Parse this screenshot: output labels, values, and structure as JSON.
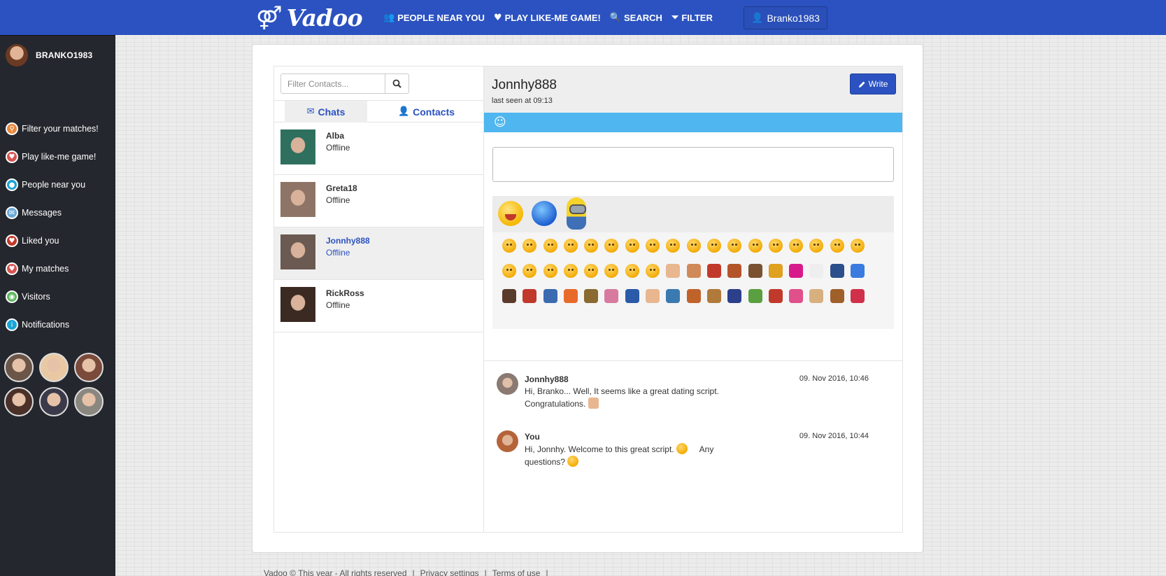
{
  "brand": {
    "symbol": "⚤",
    "name": "Vadoo"
  },
  "nav": [
    {
      "icon": "users-icon",
      "glyph": "👥",
      "label": "PEOPLE NEAR YOU"
    },
    {
      "icon": "heart-icon",
      "glyph": "♥",
      "label": "PLAY LIKE-ME GAME!"
    },
    {
      "icon": "search-icon",
      "glyph": "🔍",
      "label": "SEARCH"
    },
    {
      "icon": "filter-icon",
      "glyph": "⏷",
      "label": "FILTER"
    }
  ],
  "user_button": {
    "glyph": "👤",
    "label": "Branko1983"
  },
  "sidebar": {
    "username": "BRANKO1983",
    "items": [
      {
        "label": "Filter your matches!",
        "color": "#e8873b",
        "glyph": "⚲"
      },
      {
        "label": "Play like-me game!",
        "color": "#d9534f",
        "glyph": "♥"
      },
      {
        "label": "People near you",
        "color": "#1aa3d6",
        "glyph": "●"
      },
      {
        "label": "Messages",
        "color": "#6aa9d8",
        "glyph": "✉"
      },
      {
        "label": "Liked you",
        "color": "#c0392b",
        "glyph": "♥"
      },
      {
        "label": "My matches",
        "color": "#d9534f",
        "glyph": "♥"
      },
      {
        "label": "Visitors",
        "color": "#5cb85c",
        "glyph": "◉"
      },
      {
        "label": "Notifications",
        "color": "#1aa3d6",
        "glyph": "i"
      }
    ],
    "thumb_colors": [
      "#6b5548",
      "#e8c9a4",
      "#7a4a3a",
      "#4a3028",
      "#3a3a4a",
      "#8a8680"
    ]
  },
  "contacts_panel": {
    "search_placeholder": "Filter Contacts...",
    "tabs": [
      {
        "label": "Chats",
        "glyph": "✉"
      },
      {
        "label": "Contacts",
        "glyph": "👤"
      }
    ],
    "contacts": [
      {
        "name": "Alba",
        "status": "Offline",
        "color": "#2f6f5e"
      },
      {
        "name": "Greta18",
        "status": "Offline",
        "color": "#8d7467"
      },
      {
        "name": "Jonnhy888",
        "status": "Offline",
        "color": "#6a5a52"
      },
      {
        "name": "RickRoss",
        "status": "Offline",
        "color": "#3a2a22"
      }
    ]
  },
  "conversation": {
    "name": "Jonnhy888",
    "last_seen": "last seen at 09:13",
    "write_label": "Write",
    "messages": [
      {
        "sender": "Jonnhy888",
        "time": "09. Nov 2016, 10:46",
        "line1": "Hi, Branko... Well, It seems like a great dating script.",
        "line2": "Congratulations.",
        "avatar_color": "#8a7a72"
      },
      {
        "sender": "You",
        "time": "09. Nov 2016, 10:44",
        "line1": "Hi, Jonnhy. Welcome to this great script.",
        "line1b": "Any",
        "line2": "questions?",
        "avatar_color": "#b5643a"
      }
    ]
  },
  "footer": {
    "copyright": "Vadoo © This year - All rights reserved",
    "links": [
      "Privacy settings",
      "Terms of use"
    ]
  }
}
